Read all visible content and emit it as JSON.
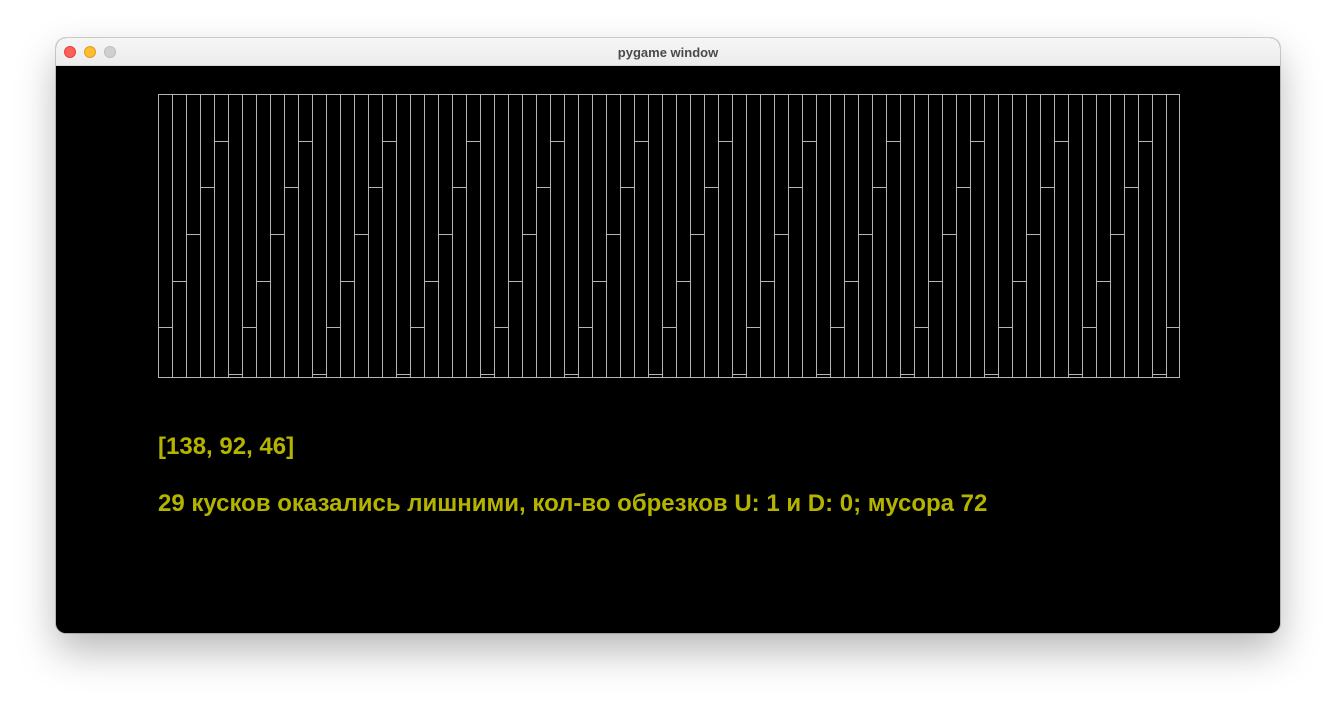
{
  "window": {
    "title": "pygame window"
  },
  "canvas": {
    "background_color": "#000000",
    "line_color": "#b4b4b4",
    "text_color": "#b4b400",
    "board": {
      "columns": 73,
      "rows": 6,
      "shape": "staggered vertical strips with horizontal cut marks"
    }
  },
  "output": {
    "lengths_text": "[138, 92, 46]",
    "summary_text": "29 кусков оказались лишними, кол-во обрезков U: 1 и D: 0; мусора 72"
  }
}
